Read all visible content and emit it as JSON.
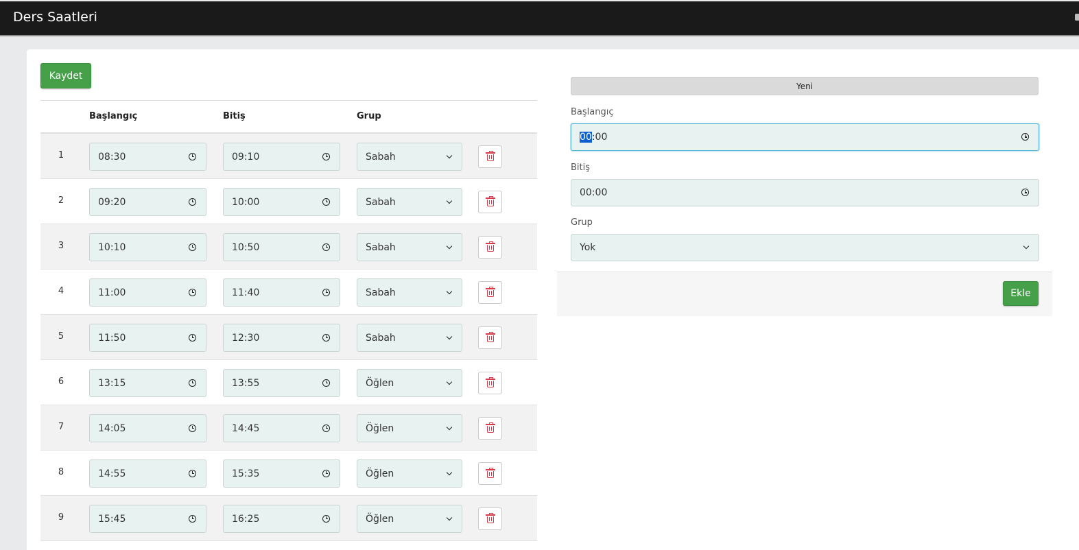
{
  "header": {
    "title": "Ders Saatleri"
  },
  "toolbar": {
    "save_label": "Kaydet"
  },
  "table": {
    "headers": {
      "start": "Başlangıç",
      "end": "Bitiş",
      "group": "Grup"
    },
    "rows": [
      {
        "num": "1",
        "start": "08:30",
        "end": "09:10",
        "group": "Sabah"
      },
      {
        "num": "2",
        "start": "09:20",
        "end": "10:00",
        "group": "Sabah"
      },
      {
        "num": "3",
        "start": "10:10",
        "end": "10:50",
        "group": "Sabah"
      },
      {
        "num": "4",
        "start": "11:00",
        "end": "11:40",
        "group": "Sabah"
      },
      {
        "num": "5",
        "start": "11:50",
        "end": "12:30",
        "group": "Sabah"
      },
      {
        "num": "6",
        "start": "13:15",
        "end": "13:55",
        "group": "Öğlen"
      },
      {
        "num": "7",
        "start": "14:05",
        "end": "14:45",
        "group": "Öğlen"
      },
      {
        "num": "8",
        "start": "14:55",
        "end": "15:35",
        "group": "Öğlen"
      },
      {
        "num": "9",
        "start": "15:45",
        "end": "16:25",
        "group": "Öğlen"
      }
    ]
  },
  "new_panel": {
    "header": "Yeni",
    "start_label": "Başlangıç",
    "start_hour": "00",
    "start_sep": ":",
    "start_minute": "00",
    "end_label": "Bitiş",
    "end_value": "00:00",
    "group_label": "Grup",
    "group_value": "Yok",
    "add_label": "Ekle"
  },
  "colors": {
    "accent_green": "#45a049",
    "delete_red": "#d83a4a",
    "input_bg": "#e8f2f1",
    "focus_border": "#55b3d6"
  },
  "icons": {
    "time": "clock-icon",
    "select": "chevron-down-icon",
    "delete": "trash-icon"
  }
}
